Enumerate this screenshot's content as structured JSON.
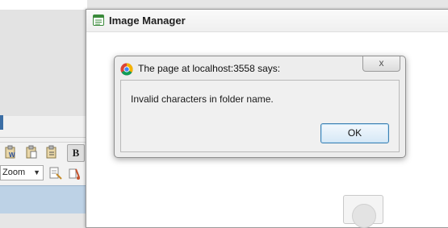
{
  "background_editor": {
    "toolbar": {
      "bold_label": "B",
      "zoom_value": "Zoom"
    }
  },
  "image_manager": {
    "title": "Image Manager"
  },
  "alert": {
    "title": "The page at localhost:3558 says:",
    "close_glyph": "x",
    "message": "Invalid characters in folder name.",
    "ok_label": "OK"
  },
  "colors": {
    "ok_border": "#3c7fb1",
    "dialog_bg": "#ededed"
  },
  "icons": [
    "doc-icon",
    "chrome-icon",
    "paste-word-icon",
    "paste-icon",
    "paste-text-icon",
    "find-replace-icon",
    "cleanup-icon"
  ]
}
